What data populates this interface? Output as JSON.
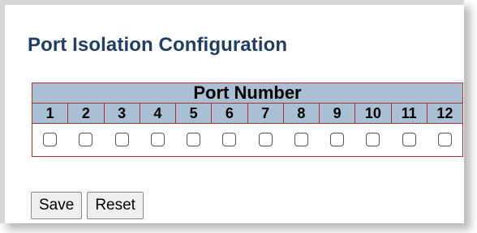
{
  "page": {
    "title": "Port Isolation Configuration"
  },
  "port_table": {
    "header": "Port Number",
    "ports": [
      "1",
      "2",
      "3",
      "4",
      "5",
      "6",
      "7",
      "8",
      "9",
      "10",
      "11",
      "12"
    ],
    "checked": [
      false,
      false,
      false,
      false,
      false,
      false,
      false,
      false,
      false,
      false,
      false,
      false
    ]
  },
  "buttons": {
    "save": "Save",
    "reset": "Reset"
  },
  "colors": {
    "title": "#1f3f66",
    "header_bg": "#a9bfd4",
    "table_border": "#b03030"
  }
}
